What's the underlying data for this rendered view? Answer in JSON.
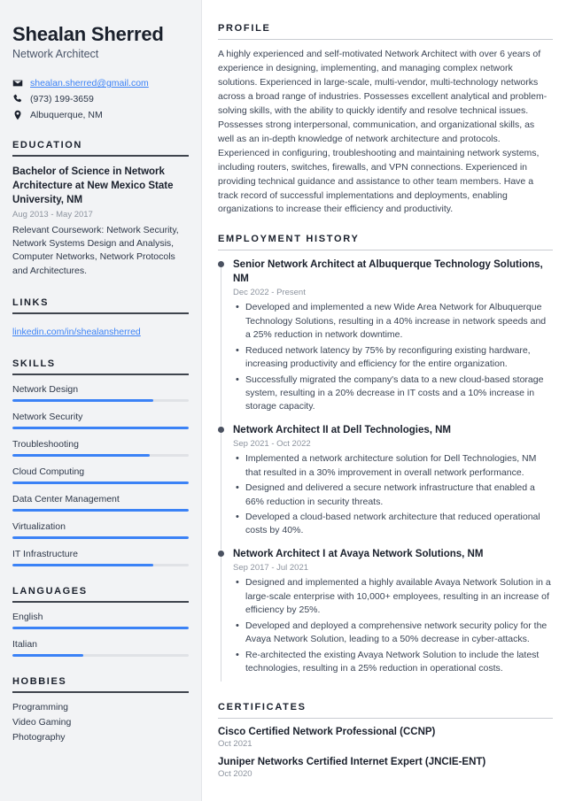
{
  "sidebar": {
    "name": "Shealan Sherred",
    "job_title": "Network Architect",
    "contacts": [
      {
        "icon": "envelope-icon",
        "value": "shealan.sherred@gmail.com",
        "is_link": true
      },
      {
        "icon": "phone-icon",
        "value": "(973) 199-3659",
        "is_link": false
      },
      {
        "icon": "location-pin-icon",
        "value": "Albuquerque, NM",
        "is_link": false
      }
    ],
    "education": {
      "heading": "EDUCATION",
      "degree": "Bachelor of Science in Network Architecture at New Mexico State University, NM",
      "date": "Aug 2013 - May 2017",
      "description": "Relevant Coursework: Network Security, Network Systems Design and Analysis, Computer Networks, Network Protocols and Architectures."
    },
    "links": {
      "heading": "LINKS",
      "items": [
        {
          "label": "linkedin.com/in/shealansherred"
        }
      ]
    },
    "skills": {
      "heading": "SKILLS",
      "items": [
        {
          "label": "Network Design",
          "level": 80
        },
        {
          "label": "Network Security",
          "level": 100
        },
        {
          "label": "Troubleshooting",
          "level": 78
        },
        {
          "label": "Cloud Computing",
          "level": 100
        },
        {
          "label": "Data Center Management",
          "level": 100
        },
        {
          "label": "Virtualization",
          "level": 100
        },
        {
          "label": "IT Infrastructure",
          "level": 80
        }
      ]
    },
    "languages": {
      "heading": "LANGUAGES",
      "items": [
        {
          "label": "English",
          "level": 100
        },
        {
          "label": "Italian",
          "level": 40
        }
      ]
    },
    "hobbies": {
      "heading": "HOBBIES",
      "items": [
        {
          "label": "Programming"
        },
        {
          "label": "Video Gaming"
        },
        {
          "label": "Photography"
        }
      ]
    }
  },
  "main": {
    "profile": {
      "heading": "PROFILE",
      "text": "A highly experienced and self-motivated Network Architect with over 6 years of experience in designing, implementing, and managing complex network solutions. Experienced in large-scale, multi-vendor, multi-technology networks across a broad range of industries. Possesses excellent analytical and problem-solving skills, with the ability to quickly identify and resolve technical issues. Possesses strong interpersonal, communication, and organizational skills, as well as an in-depth knowledge of network architecture and protocols. Experienced in configuring, troubleshooting and maintaining network systems, including routers, switches, firewalls, and VPN connections. Experienced in providing technical guidance and assistance to other team members. Have a track record of successful implementations and deployments, enabling organizations to increase their efficiency and productivity."
    },
    "employment": {
      "heading": "EMPLOYMENT HISTORY",
      "jobs": [
        {
          "role": "Senior Network Architect at Albuquerque Technology Solutions, NM",
          "date": "Dec 2022 - Present",
          "points": [
            "Developed and implemented a new Wide Area Network for Albuquerque Technology Solutions, resulting in a 40% increase in network speeds and a 25% reduction in network downtime.",
            "Reduced network latency by 75% by reconfiguring existing hardware, increasing productivity and efficiency for the entire organization.",
            "Successfully migrated the company's data to a new cloud-based storage system, resulting in a 20% decrease in IT costs and a 10% increase in storage capacity."
          ]
        },
        {
          "role": "Network Architect II at Dell Technologies, NM",
          "date": "Sep 2021 - Oct 2022",
          "points": [
            "Implemented a network architecture solution for Dell Technologies, NM that resulted in a 30% improvement in overall network performance.",
            "Designed and delivered a secure network infrastructure that enabled a 66% reduction in security threats.",
            "Developed a cloud-based network architecture that reduced operational costs by 40%."
          ]
        },
        {
          "role": "Network Architect I at Avaya Network Solutions, NM",
          "date": "Sep 2017 - Jul 2021",
          "points": [
            "Designed and implemented a highly available Avaya Network Solution in a large-scale enterprise with 10,000+ employees, resulting in an increase of efficiency by 25%.",
            "Developed and deployed a comprehensive network security policy for the Avaya Network Solution, leading to a 50% decrease in cyber-attacks.",
            "Re-architected the existing Avaya Network Solution to include the latest technologies, resulting in a 25% reduction in operational costs."
          ]
        }
      ]
    },
    "certificates": {
      "heading": "CERTIFICATES",
      "items": [
        {
          "name": "Cisco Certified Network Professional (CCNP)",
          "date": "Oct 2021"
        },
        {
          "name": "Juniper Networks Certified Internet Expert (JNCIE-ENT)",
          "date": "Oct 2020"
        }
      ]
    }
  },
  "colors": {
    "accent": "#3b82f6",
    "sidebar_bg": "#f2f3f5",
    "heading": "#1a202c",
    "muted": "#8c939e"
  }
}
